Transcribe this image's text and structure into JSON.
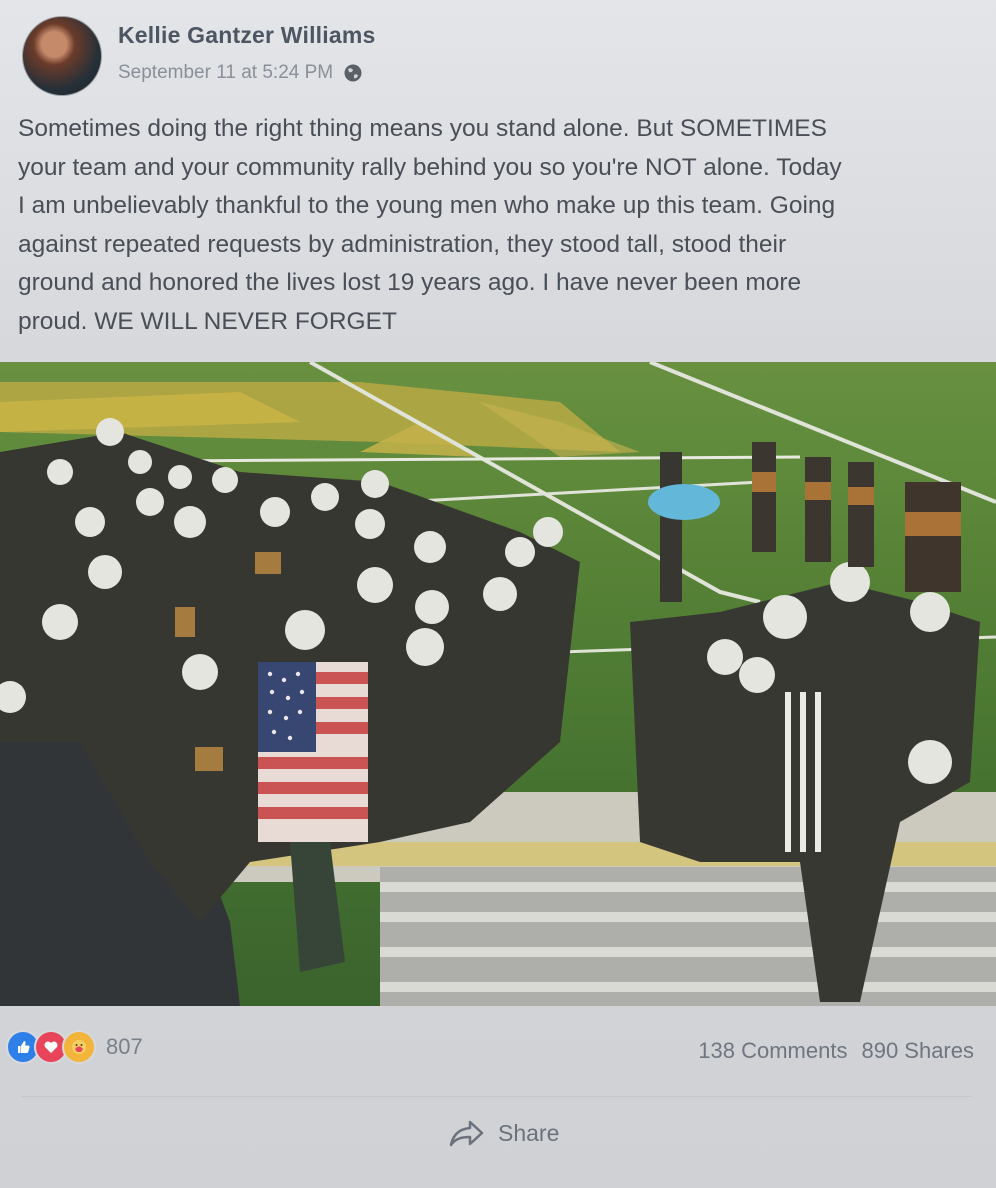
{
  "post": {
    "author": "Kellie Gantzer Williams",
    "timestamp": "September 11 at 5:24 PM",
    "privacy_icon": "globe-icon",
    "text_lines": [
      "Sometimes doing the right thing means you stand alone. But SOMETIMES",
      "your team and your community rally behind you so you're NOT alone. Today",
      "I am unbelievably thankful to the young men who make up this team. Going",
      "against repeated requests by administration, they stood tall, stood their",
      "ground and honored the lives lost 19 years ago. I have never been more",
      "proud. WE WILL NEVER FORGET"
    ]
  },
  "engagement": {
    "reaction_icons": [
      "like-icon",
      "love-icon",
      "care-icon"
    ],
    "reaction_count": "807",
    "comments": "138 Comments",
    "shares": "890 Shares"
  },
  "actions": {
    "share_label": "Share"
  },
  "colors": {
    "like": "#2f7fe8",
    "love": "#e8455b",
    "care": "#f2b43a"
  }
}
